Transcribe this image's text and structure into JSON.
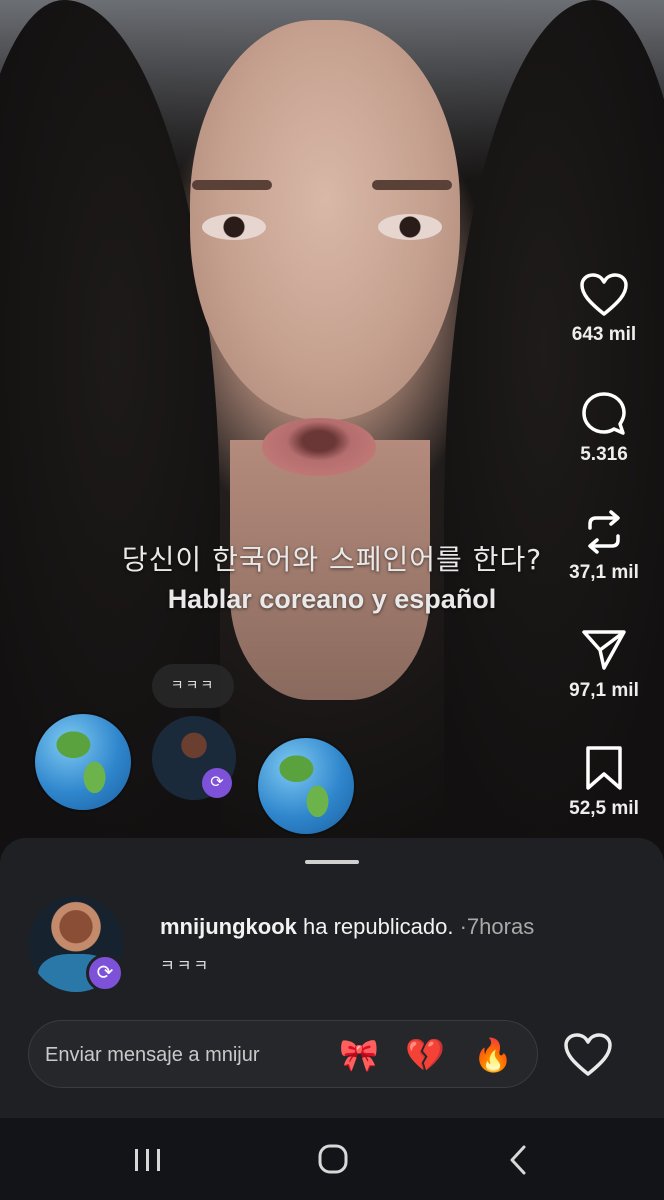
{
  "video": {
    "caption_ko": "당신이 한국어와 스페인어를 한다?",
    "caption_es": "Hablar coreano y español"
  },
  "actions": {
    "likes": "643 mil",
    "comments": "5.316",
    "reposts": "37,1 mil",
    "shares": "97,1 mil",
    "saves": "52,5 mil"
  },
  "repost_row": {
    "bubble_text": "ㅋㅋㅋ"
  },
  "sheet": {
    "username": "mnijungkook",
    "action_text": "ha republicado.",
    "separator": "·",
    "time": "7horas",
    "comment": "ㅋㅋㅋ",
    "composer_placeholder": "Enviar mensaje a mnijur",
    "emojis": [
      "🎀",
      "💔",
      "🔥"
    ]
  },
  "colors": {
    "sheet_bg": "#1f2023",
    "repost_badge": "#7d52d8",
    "navbar_bg": "#131417"
  }
}
